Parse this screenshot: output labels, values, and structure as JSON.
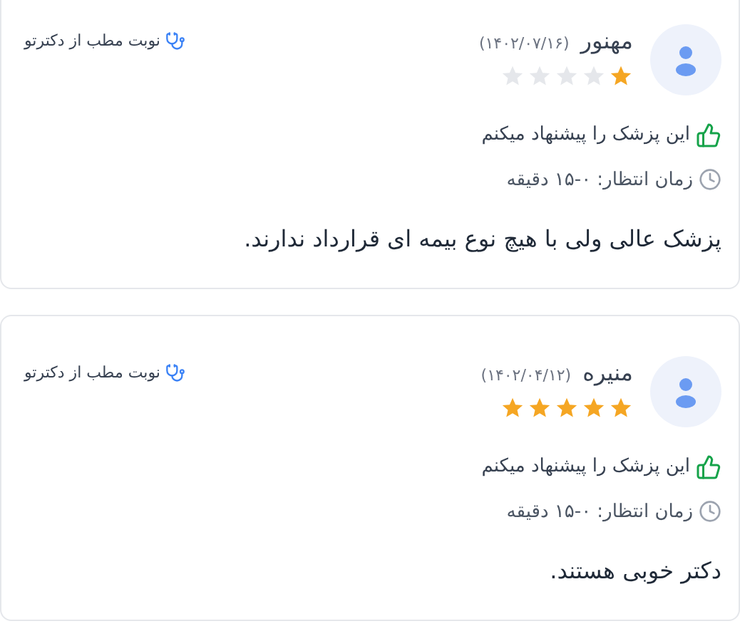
{
  "reviews": [
    {
      "name": "مهنور",
      "date": "(۱۴۰۲/۰۷/۱۶)",
      "stars": 1,
      "source": "نوبت مطب از دکترتو",
      "recommend": "این پزشک را پیشنهاد میکنم",
      "wait": "زمان انتظار: ۰-۱۵ دقیقه",
      "comment": "پزشک عالی ولی با هیچ نوع بیمه ای قرارداد ندارند."
    },
    {
      "name": "منیره",
      "date": "(۱۴۰۲/۰۴/۱۲)",
      "stars": 5,
      "source": "نوبت مطب از دکترتو",
      "recommend": "این پزشک را پیشنهاد میکنم",
      "wait": "زمان انتظار: ۰-۱۵ دقیقه",
      "comment": "دکتر خوبی هستند."
    }
  ]
}
